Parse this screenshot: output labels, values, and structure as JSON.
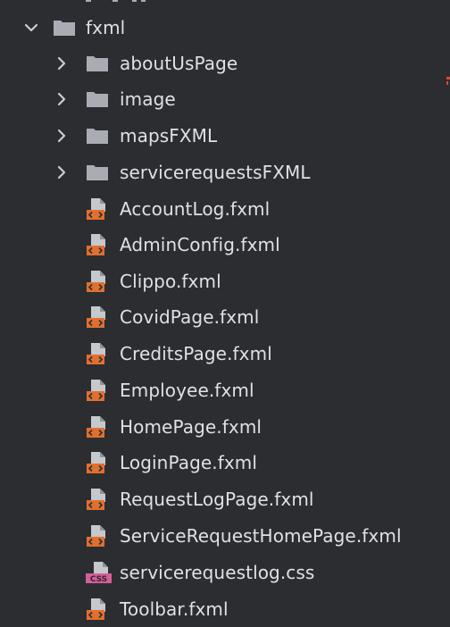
{
  "colors": {
    "background": "#2b2d30",
    "text": "#dfe1e5",
    "chevron": "#c9ccd1",
    "folder": "#a9adb3",
    "fxml_orange": "#e0702f",
    "fxml_sheet": "#c5c8cd",
    "css_badge": "#d15f99",
    "css_text": "#3b2333",
    "edge_marker": "#d9473a"
  },
  "tree": {
    "root": {
      "label": "fxml",
      "expanded": true,
      "icon": "folder-icon",
      "chevron": "chevron-down-icon"
    },
    "folders": [
      {
        "label": "aboutUsPage",
        "icon": "folder-icon",
        "chevron": "chevron-right-icon"
      },
      {
        "label": "image",
        "icon": "folder-icon",
        "chevron": "chevron-right-icon"
      },
      {
        "label": "mapsFXML",
        "icon": "folder-icon",
        "chevron": "chevron-right-icon"
      },
      {
        "label": "servicerequestsFXML",
        "icon": "folder-icon",
        "chevron": "chevron-right-icon"
      }
    ],
    "files": [
      {
        "label": "AccountLog.fxml",
        "icon": "fxml-file-icon"
      },
      {
        "label": "AdminConfig.fxml",
        "icon": "fxml-file-icon"
      },
      {
        "label": "Clippo.fxml",
        "icon": "fxml-file-icon"
      },
      {
        "label": "CovidPage.fxml",
        "icon": "fxml-file-icon"
      },
      {
        "label": "CreditsPage.fxml",
        "icon": "fxml-file-icon"
      },
      {
        "label": "Employee.fxml",
        "icon": "fxml-file-icon"
      },
      {
        "label": "HomePage.fxml",
        "icon": "fxml-file-icon"
      },
      {
        "label": "LoginPage.fxml",
        "icon": "fxml-file-icon"
      },
      {
        "label": "RequestLogPage.fxml",
        "icon": "fxml-file-icon"
      },
      {
        "label": "ServiceRequestHomePage.fxml",
        "icon": "fxml-file-icon"
      },
      {
        "label": "servicerequestlog.css",
        "icon": "css-file-icon",
        "badge": "CSS"
      },
      {
        "label": "Toolbar.fxml",
        "icon": "fxml-file-icon"
      }
    ]
  }
}
